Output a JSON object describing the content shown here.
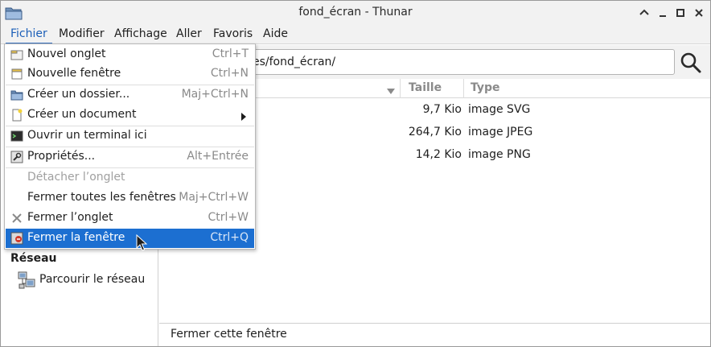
{
  "window": {
    "title": "fond_écran - Thunar",
    "controls": [
      "chevron-up-icon",
      "minimize-icon",
      "maximize-icon",
      "close-icon"
    ]
  },
  "menubar": {
    "items": [
      "Fichier",
      "Modifier",
      "Affichage",
      "Aller",
      "Favoris",
      "Aide"
    ],
    "active": "Fichier"
  },
  "pathbar": {
    "location_visible": "es/fond_écran/"
  },
  "sidebar": {
    "network_heading": "Réseau",
    "browse_network": "Parcourir le réseau"
  },
  "filelist": {
    "columns": {
      "size": "Taille",
      "type": "Type"
    },
    "rows": [
      {
        "size": "9,7 Kio",
        "type": "image SVG"
      },
      {
        "size": "264,7 Kio",
        "type": "image JPEG"
      },
      {
        "size": "14,2 Kio",
        "type": "image PNG"
      }
    ]
  },
  "statusbar": {
    "text": "Fermer cette fenêtre"
  },
  "file_menu": {
    "items": [
      {
        "label": "Nouvel onglet",
        "shortcut": "Ctrl+T",
        "icon": "new-tab-icon"
      },
      {
        "label": "Nouvelle fenêtre",
        "shortcut": "Ctrl+N",
        "icon": "new-window-icon"
      },
      {
        "label": "Créer un dossier...",
        "shortcut": "Maj+Ctrl+N",
        "icon": "folder-icon"
      },
      {
        "label": "Créer un document",
        "shortcut": "",
        "icon": "document-icon"
      },
      {
        "label": "Ouvrir un terminal ici",
        "shortcut": "",
        "icon": "terminal-icon"
      },
      {
        "label": "Propriétés...",
        "shortcut": "Alt+Entrée",
        "icon": "properties-icon"
      },
      {
        "label": "Détacher l’onglet",
        "shortcut": "",
        "icon": ""
      },
      {
        "label": "Fermer toutes les fenêtres",
        "shortcut": "Maj+Ctrl+W",
        "icon": ""
      },
      {
        "label": "Fermer l’onglet",
        "shortcut": "Ctrl+W",
        "icon": "close-tab-icon"
      },
      {
        "label": "Fermer la fenêtre",
        "shortcut": "Ctrl+Q",
        "icon": "close-window-icon"
      }
    ]
  },
  "colors": {
    "selection": "#1c6fd1",
    "active_menu": "#1c5fb8"
  }
}
